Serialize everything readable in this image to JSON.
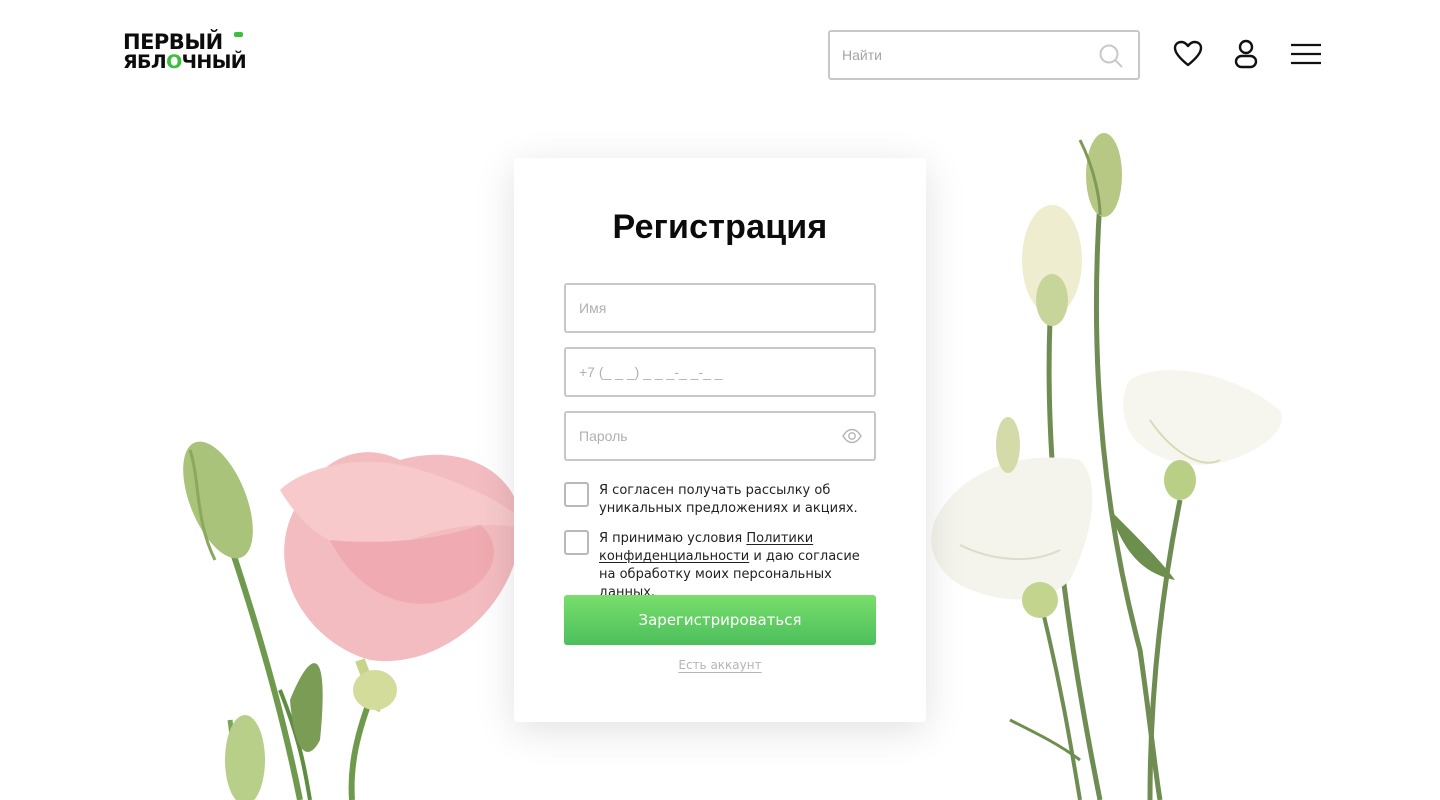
{
  "header": {
    "logo_line1": "ПЕРВЫЙ",
    "logo_line2_part1": "ЯБЛ",
    "logo_line2_o": "О",
    "logo_line2_part2": "ЧНЫЙ",
    "search_placeholder": "Найти",
    "icons": [
      "search-icon",
      "heart-icon",
      "user-icon",
      "menu-icon"
    ]
  },
  "form": {
    "title": "Регистрация",
    "name_placeholder": "Имя",
    "phone_placeholder": "+7 (_ _ _) _ _ _-_ _-_ _",
    "password_placeholder": "Пароль",
    "newsletter_label": "Я согласен получать рассылку об уникальных предложениях и акциях.",
    "terms_prefix": "Я принимаю условия ",
    "terms_link": "Политики конфиденциальности",
    "terms_suffix": " и даю согласие на обработку моих персональных данных.",
    "submit_label": "Зарегистрироваться",
    "login_link": "Есть аккаунт"
  },
  "colors": {
    "accent_green": "#4cbf5c",
    "accent_green_light": "#79de6c",
    "border": "#c8c8c8",
    "text": "#111111"
  }
}
